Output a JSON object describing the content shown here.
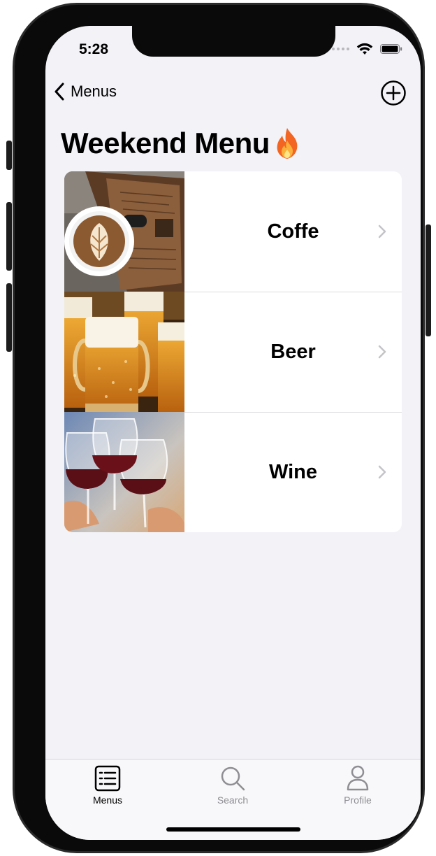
{
  "status": {
    "time": "5:28"
  },
  "nav": {
    "back_label": "Menus"
  },
  "page": {
    "title": "Weekend Menu",
    "emoji": "🔥"
  },
  "items": [
    {
      "label": "Coffe",
      "image": "latte-art-coffee-cup"
    },
    {
      "label": "Beer",
      "image": "beer-mugs"
    },
    {
      "label": "Wine",
      "image": "red-wine-glasses-toast"
    }
  ],
  "tabs": [
    {
      "label": "Menus",
      "icon": "list-icon",
      "active": true
    },
    {
      "label": "Search",
      "icon": "magnifier-icon",
      "active": false
    },
    {
      "label": "Profile",
      "icon": "person-icon",
      "active": false
    }
  ],
  "colors": {
    "active": "#000000",
    "inactive": "#8e8e93",
    "background": "#f2f2f7"
  }
}
